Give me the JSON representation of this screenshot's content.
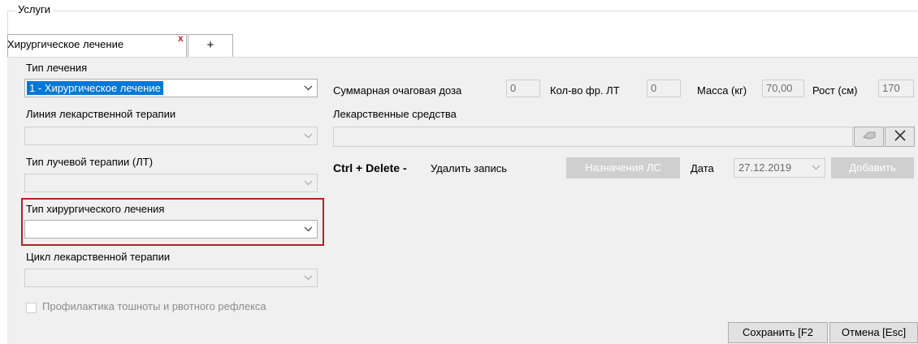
{
  "groupbox": {
    "title": "Услуги"
  },
  "tabs": [
    {
      "label": "Хирургическое лечение",
      "close": "x"
    },
    {
      "label": "+"
    }
  ],
  "left": {
    "treatment_type": {
      "label": "Тип лечения",
      "value": "1 - Хирургическое лечение"
    },
    "drug_therapy_line": {
      "label": "Линия лекарственной терапии",
      "value": ""
    },
    "radiation_type": {
      "label": "Тип лучевой терапии (ЛТ)",
      "value": ""
    },
    "surgical_type": {
      "label": "Тип хирургического лечения",
      "value": ""
    },
    "drug_cycle": {
      "label": "Цикл лекарственной терапии",
      "value": ""
    },
    "nausea_prophylaxis": {
      "label": "Профилактика тошноты и рвотного рефлекса",
      "checked": false
    }
  },
  "right": {
    "total_dose": {
      "label": "Суммарная очаговая доза",
      "value": "0"
    },
    "fractions": {
      "label": "Кол-во фр. ЛТ",
      "value": "0"
    },
    "mass": {
      "label": "Масса (кг)",
      "value": "70,00"
    },
    "height": {
      "label": "Рост (см)",
      "value": "170"
    },
    "drugs": {
      "label": "Лекарственные средства",
      "value": ""
    },
    "hint_key": "Ctrl + Delete -",
    "hint_text": "Удалить запись",
    "prescriptions_button": "Назначения ЛС",
    "date_label": "Дата",
    "date_value": "27.12.2019",
    "add_button": "Добавить"
  },
  "footer": {
    "save_button": "Сохранить [F2",
    "cancel_button": "Отмена [Esc]"
  },
  "colors": {
    "highlight": "#b22222",
    "selection": "#0078d7",
    "tab_close": "#d62020"
  }
}
